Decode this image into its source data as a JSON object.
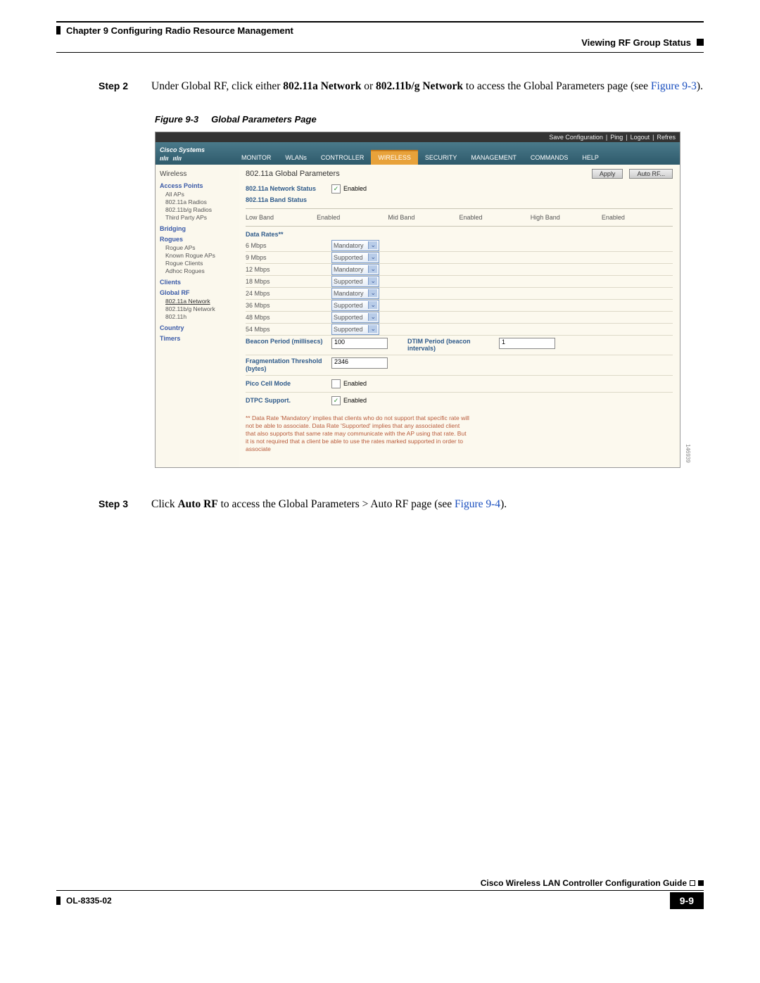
{
  "header": {
    "chapter_line": "Chapter 9    Configuring Radio Resource Management",
    "section": "Viewing RF Group Status"
  },
  "steps": {
    "s2_label": "Step 2",
    "s2_text_1": "Under Global RF, click either ",
    "s2_bold_1": "802.11a Network",
    "s2_text_2": " or ",
    "s2_bold_2": "802.11b/g Network",
    "s2_text_3": " to access the Global Parameters page (see ",
    "s2_link": "Figure 9-3",
    "s2_end": ").",
    "s3_label": "Step 3",
    "s3_text_1": "Click ",
    "s3_bold_1": "Auto RF",
    "s3_text_2": " to access the Global Parameters > Auto RF page (see ",
    "s3_link": "Figure 9-4",
    "s3_end": ")."
  },
  "figure": {
    "num": "Figure 9-3",
    "title": "Global Parameters Page"
  },
  "sc": {
    "logo": "Cisco Systems",
    "toplinks": {
      "save": "Save Configuration",
      "ping": "Ping",
      "logout": "Logout",
      "refresh": "Refres"
    },
    "menu": [
      "MONITOR",
      "WLANs",
      "CONTROLLER",
      "WIRELESS",
      "SECURITY",
      "MANAGEMENT",
      "COMMANDS",
      "HELP"
    ],
    "active_menu": 3,
    "sidebar": {
      "title": "Wireless",
      "groups": [
        {
          "h": "Access Points",
          "items": [
            "All APs",
            "802.11a Radios",
            "802.11b/g Radios",
            "Third Party APs"
          ]
        },
        {
          "h": "Bridging",
          "items": []
        },
        {
          "h": "Rogues",
          "items": [
            "Rogue APs",
            "Known Rogue APs",
            "Rogue Clients",
            "Adhoc Rogues"
          ]
        },
        {
          "h": "Clients",
          "items": []
        },
        {
          "h": "Global RF",
          "items": [
            "802.11a Network",
            "802.11b/g Network",
            "802.11h"
          ],
          "selected": 0
        },
        {
          "h": "Country",
          "items": []
        },
        {
          "h": "Timers",
          "items": []
        }
      ]
    },
    "main": {
      "title": "802.11a Global Parameters",
      "apply": "Apply",
      "autorf": "Auto RF...",
      "net_status_label": "802.11a Network Status",
      "enabled": "Enabled",
      "band_status_label": "802.11a Band Status",
      "bands": [
        {
          "name": "Low Band",
          "status": "Enabled"
        },
        {
          "name": "Mid Band",
          "status": "Enabled"
        },
        {
          "name": "High Band",
          "status": "Enabled"
        }
      ],
      "data_rates_label": "Data Rates**",
      "rates": [
        {
          "r": "6 Mbps",
          "v": "Mandatory"
        },
        {
          "r": "9 Mbps",
          "v": "Supported"
        },
        {
          "r": "12 Mbps",
          "v": "Mandatory"
        },
        {
          "r": "18 Mbps",
          "v": "Supported"
        },
        {
          "r": "24 Mbps",
          "v": "Mandatory"
        },
        {
          "r": "36 Mbps",
          "v": "Supported"
        },
        {
          "r": "48 Mbps",
          "v": "Supported"
        },
        {
          "r": "54 Mbps",
          "v": "Supported"
        }
      ],
      "beacon_label": "Beacon Period (millisecs)",
      "beacon_val": "100",
      "dtim_label": "DTIM Period (beacon intervals)",
      "dtim_val": "1",
      "frag_label": "Fragmentation Threshold (bytes)",
      "frag_val": "2346",
      "pico_label": "Pico Cell Mode",
      "dtpc_label": "DTPC Support.",
      "note": "** Data Rate 'Mandatory' implies that clients who do not support that specific rate will not be able to associate. Data Rate 'Supported' implies that any associated client that also supports that same rate may communicate with the AP using that rate. But it is not required that a client be able to use the rates marked supported in order to associate",
      "imgnum": "146939"
    }
  },
  "footer": {
    "guide": "Cisco Wireless LAN Controller Configuration Guide",
    "doc": "OL-8335-02",
    "page": "9-9"
  }
}
